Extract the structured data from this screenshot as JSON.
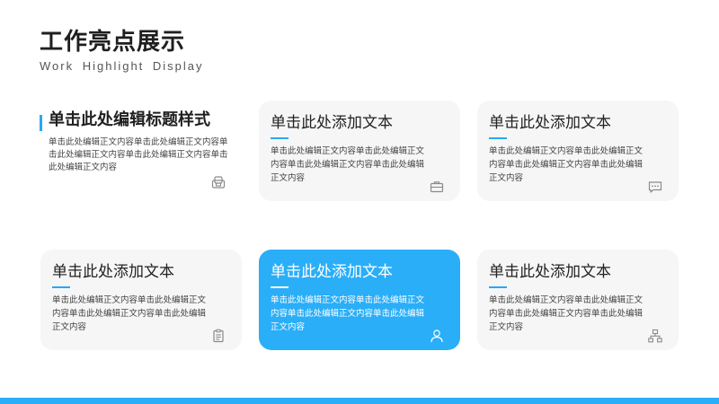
{
  "header": {
    "title": "工作亮点展示",
    "subtitle": "Work  Highlight  Display"
  },
  "feature": {
    "heading": "单击此处编辑标题样式",
    "body": "单击此处编辑正文内容单击此处编辑正文内容单击此处编辑正文内容单击此处编辑正文内容单击此处编辑正文内容",
    "icon": "copy-icon"
  },
  "cards": [
    {
      "heading": "单击此处添加文本",
      "body": "单击此处编辑正文内容单击此处编辑正文内容单击此处编辑正文内容单击此处编辑正文内容",
      "icon": "briefcase-icon",
      "active": false
    },
    {
      "heading": "单击此处添加文本",
      "body": "单击此处编辑正文内容单击此处编辑正文内容单击此处编辑正文内容单击此处编辑正文内容",
      "icon": "chat-icon",
      "active": false
    },
    {
      "heading": "单击此处添加文本",
      "body": "单击此处编辑正文内容单击此处编辑正文内容单击此处编辑正文内容单击此处编辑正文内容",
      "icon": "clipboard-icon",
      "active": false
    },
    {
      "heading": "单击此处添加文本",
      "body": "单击此处编辑正文内容单击此处编辑正文内容单击此处编辑正文内容单击此处编辑正文内容",
      "icon": "user-icon",
      "active": true
    },
    {
      "heading": "单击此处添加文本",
      "body": "单击此处编辑正文内容单击此处编辑正文内容单击此处编辑正文内容单击此处编辑正文内容",
      "icon": "sitemap-icon",
      "active": false
    }
  ],
  "colors": {
    "accent": "#2aaef8",
    "card_bg": "#f6f6f6",
    "title": "#1f1f1f",
    "body_text": "#444444"
  }
}
